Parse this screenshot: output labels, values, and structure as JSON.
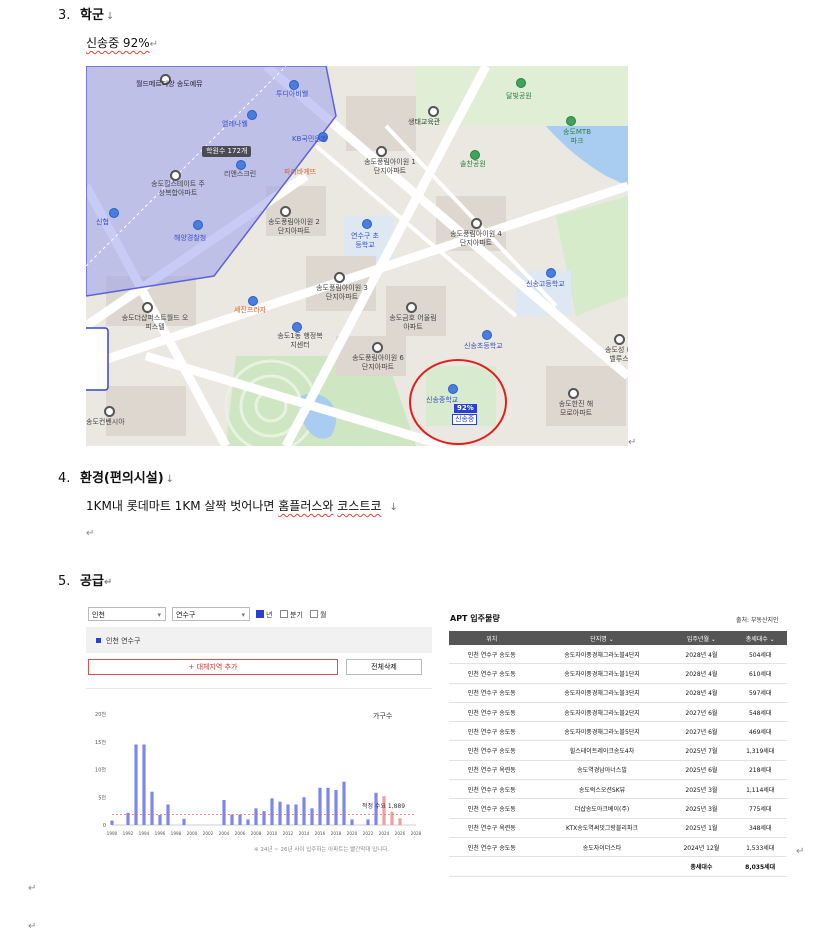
{
  "doc": {
    "s3": {
      "num": "3.",
      "title": "학군",
      "body": "신송중 92%"
    },
    "s4": {
      "num": "4.",
      "title": "환경(편의시설)",
      "body_pre": "1KM내 롯데마트 1KM 살짝 벗어나면 ",
      "body_a": "홈플러스와",
      "body_mid": " ",
      "body_b": "코스트코"
    },
    "s5": {
      "num": "5.",
      "title": "공급"
    },
    "pilcrow": "↵",
    "para_mark": "↓"
  },
  "map": {
    "labels": [
      "월드메르디앙 송도예뮤",
      "투디아비웰",
      "엘레나웰",
      "KB국민은행",
      "리앤스크린",
      "파리바게뜨",
      "송도힐스테이트 주상복합아파트",
      "해양경찰청",
      "신협",
      "학원수 172개",
      "생태교육관",
      "달빛공원",
      "솔찬공원",
      "송도MTB 파크",
      "송도풍림아이원 1단지아파트",
      "송도풍림아이원 2단지아파트",
      "연수구 초등학교",
      "송도풍림아이원 4단지아파트",
      "신송고등학교",
      "송도풍림아이원 3단지아파트",
      "송도금호 어울림아파트",
      "세진프라자",
      "송도더샵퍼스트월드 오피스텔",
      "송도1동 행정복지센터",
      "신송초등학교",
      "송도풍림아이원 6단지아파트",
      "송도한진 해모로아파트",
      "송도성 라벨루스",
      "송도컨벤시아",
      "신송중학교",
      "92%",
      "신송중"
    ]
  },
  "supply": {
    "filters": {
      "city": "인천",
      "district": "연수구",
      "opt_year": "년",
      "opt_quarter": "분기",
      "opt_month": "월"
    },
    "legend_item": "인천 연수구",
    "add_btn": "+ 대체지역 추가",
    "del_btn": "전체삭제",
    "unit_label": "가구수",
    "avg_label": "적정 수요 1,889",
    "footnote": "※ 24년 ~ 26년 사이 입주하는 아파트는 빨간막대 입니다."
  },
  "chart_data": {
    "type": "bar",
    "title": "",
    "xlabel": "",
    "ylabel": "가구수",
    "ylim": [
      0,
      20000
    ],
    "y_ticks": [
      "0",
      "5천",
      "10천",
      "15천",
      "20천"
    ],
    "x_tick_labels": [
      "1990",
      "1992",
      "1994",
      "1996",
      "1998",
      "2000",
      "2002",
      "2004",
      "2006",
      "2008",
      "2010",
      "2012",
      "2014",
      "2016",
      "2018",
      "2020",
      "2022",
      "2024",
      "2026",
      "2028"
    ],
    "reference_line": {
      "label": "적정 수요 1,889",
      "value": 1889
    },
    "series": [
      {
        "name": "인천 연수구",
        "x": [
          1990,
          1991,
          1992,
          1993,
          1994,
          1995,
          1996,
          1997,
          1998,
          1999,
          2000,
          2001,
          2002,
          2003,
          2004,
          2005,
          2006,
          2007,
          2008,
          2009,
          2010,
          2011,
          2012,
          2013,
          2014,
          2015,
          2016,
          2017,
          2018,
          2019,
          2020,
          2021,
          2022,
          2023
        ],
        "values": [
          800,
          0,
          2200,
          14500,
          14500,
          6000,
          1800,
          3700,
          0,
          1100,
          0,
          0,
          0,
          0,
          4500,
          1900,
          1900,
          1000,
          3000,
          2500,
          4800,
          4200,
          3700,
          3700,
          5000,
          3000,
          6700,
          6700,
          6300,
          7800,
          1000,
          0,
          1000,
          5800
        ]
      },
      {
        "name": "24~26년 입주",
        "x": [
          2024,
          2025,
          2026
        ],
        "values": [
          5200,
          2400,
          1200
        ]
      }
    ]
  },
  "apt_table": {
    "title": "APT 입주물량",
    "source": "출처: 부동산지인",
    "headers": [
      "위치",
      "단지명 ⌄",
      "입주년월 ⌄",
      "총세대수 ⌄"
    ],
    "rows": [
      [
        "인천 연수구 송도동",
        "송도자이풍경채그라노블4단지",
        "2028년 4월",
        "504세대"
      ],
      [
        "인천 연수구 송도동",
        "송도자이풍경채그라노블1단지",
        "2028년 4월",
        "610세대"
      ],
      [
        "인천 연수구 송도동",
        "송도자이풍경채그라노블3단지",
        "2028년 4월",
        "597세대"
      ],
      [
        "인천 연수구 송도동",
        "송도자이풍경채그라노블2단지",
        "2027년 6월",
        "548세대"
      ],
      [
        "인천 연수구 송도동",
        "송도자이풍경채그라노블5단지",
        "2027년 6월",
        "469세대"
      ],
      [
        "인천 연수구 송도동",
        "힐스테이트레이크송도4차",
        "2025년 7월",
        "1,319세대"
      ],
      [
        "인천 연수구 옥련동",
        "송도역경남아너스빌",
        "2025년 6월",
        "218세대"
      ],
      [
        "인천 연수구 송도동",
        "송도럭스오션SK뷰",
        "2025년 3월",
        "1,114세대"
      ],
      [
        "인천 연수구 송도동",
        "더샵송도아크베이(주)",
        "2025년 3월",
        "775세대"
      ],
      [
        "인천 연수구 옥련동",
        "KTX송도역써밋그랑블리파크",
        "2025년 1월",
        "348세대"
      ],
      [
        "인천 연수구 송도동",
        "송도자이더스타",
        "2024년 12월",
        "1,533세대"
      ]
    ],
    "total_label": "총세대수",
    "total_value": "8,035세대"
  }
}
